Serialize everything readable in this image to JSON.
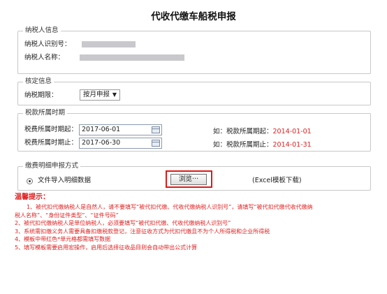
{
  "page": {
    "title": "代收代缴车船税申报"
  },
  "taxpayer": {
    "legend": "纳税人信息",
    "id_label": "纳税人识别号：",
    "name_label": "纳税人名称："
  },
  "verify": {
    "legend": "核定信息",
    "period_label": "纳税期限：",
    "period_value": "按月申报"
  },
  "period": {
    "legend": "税款所属时期",
    "start_label": "税费所属时期起：",
    "start_value": "2017-06-01",
    "end_label": "税费所属时期止：",
    "end_value": "2017-06-30",
    "ex_start_prefix": "如：税款所属期起：",
    "ex_start_value": "2014-01-01",
    "ex_end_prefix": "如：税款所属期止：",
    "ex_end_value": "2014-01-31"
  },
  "detail": {
    "legend": "缴费明细申报方式",
    "option_label": "文件导入明细数据",
    "browse_label": "浏览···",
    "excel_link": "(Excel模板下载)"
  },
  "tips": {
    "title": "温馨提示：",
    "lines": [
      "1、被代扣代缴纳税人是自然人，请不要填写“被代扣代缴、代收代缴纳税人识别号”，请填写“被代扣代缴代收代缴纳",
      "税人名称”、“身份证件类型”、“证件号码”",
      "2、被代扣代缴纳税人是单位纳税人，必须要填写“被代扣代缴、代收代缴纳税人识别号”",
      "3、系统需扣缴义务人需要具备扣缴税款登记，注意征收方式为代扣代缴且不为个人所得税和企业所得税",
      "4、模板中带红色*单元格都需填写数据",
      "5、填写模板需要启用宏操作，启用后选择征收品目则会自动带出公式计算"
    ]
  },
  "colors": {
    "tip_red": "#e02020",
    "highlight": "#e01818"
  }
}
